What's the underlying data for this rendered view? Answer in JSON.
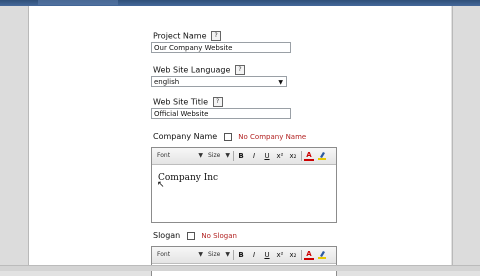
{
  "form": {
    "project_name_label": "Project Name",
    "project_name_value": "Our Company Website",
    "language_label": "Web Site Language",
    "language_value": "english",
    "site_title_label": "Web Site Title",
    "site_title_value": "Official Website",
    "company_name_label": "Company Name",
    "company_name_hint": "No Company Name",
    "company_name_value": "Company Inc",
    "slogan_label": "Slogan",
    "slogan_hint": "No Slogan"
  },
  "editor": {
    "font_label": "Font",
    "size_label": "Size",
    "bold": "B",
    "italic": "I",
    "underline": "U",
    "superscript": "x²",
    "subscript": "x₂",
    "text_color": "A"
  },
  "icons": {
    "help": "?",
    "dropdown": "▼",
    "pointer": "↖"
  },
  "colors": {
    "hint": "#b22222",
    "titlebar": "#3a5b87"
  }
}
